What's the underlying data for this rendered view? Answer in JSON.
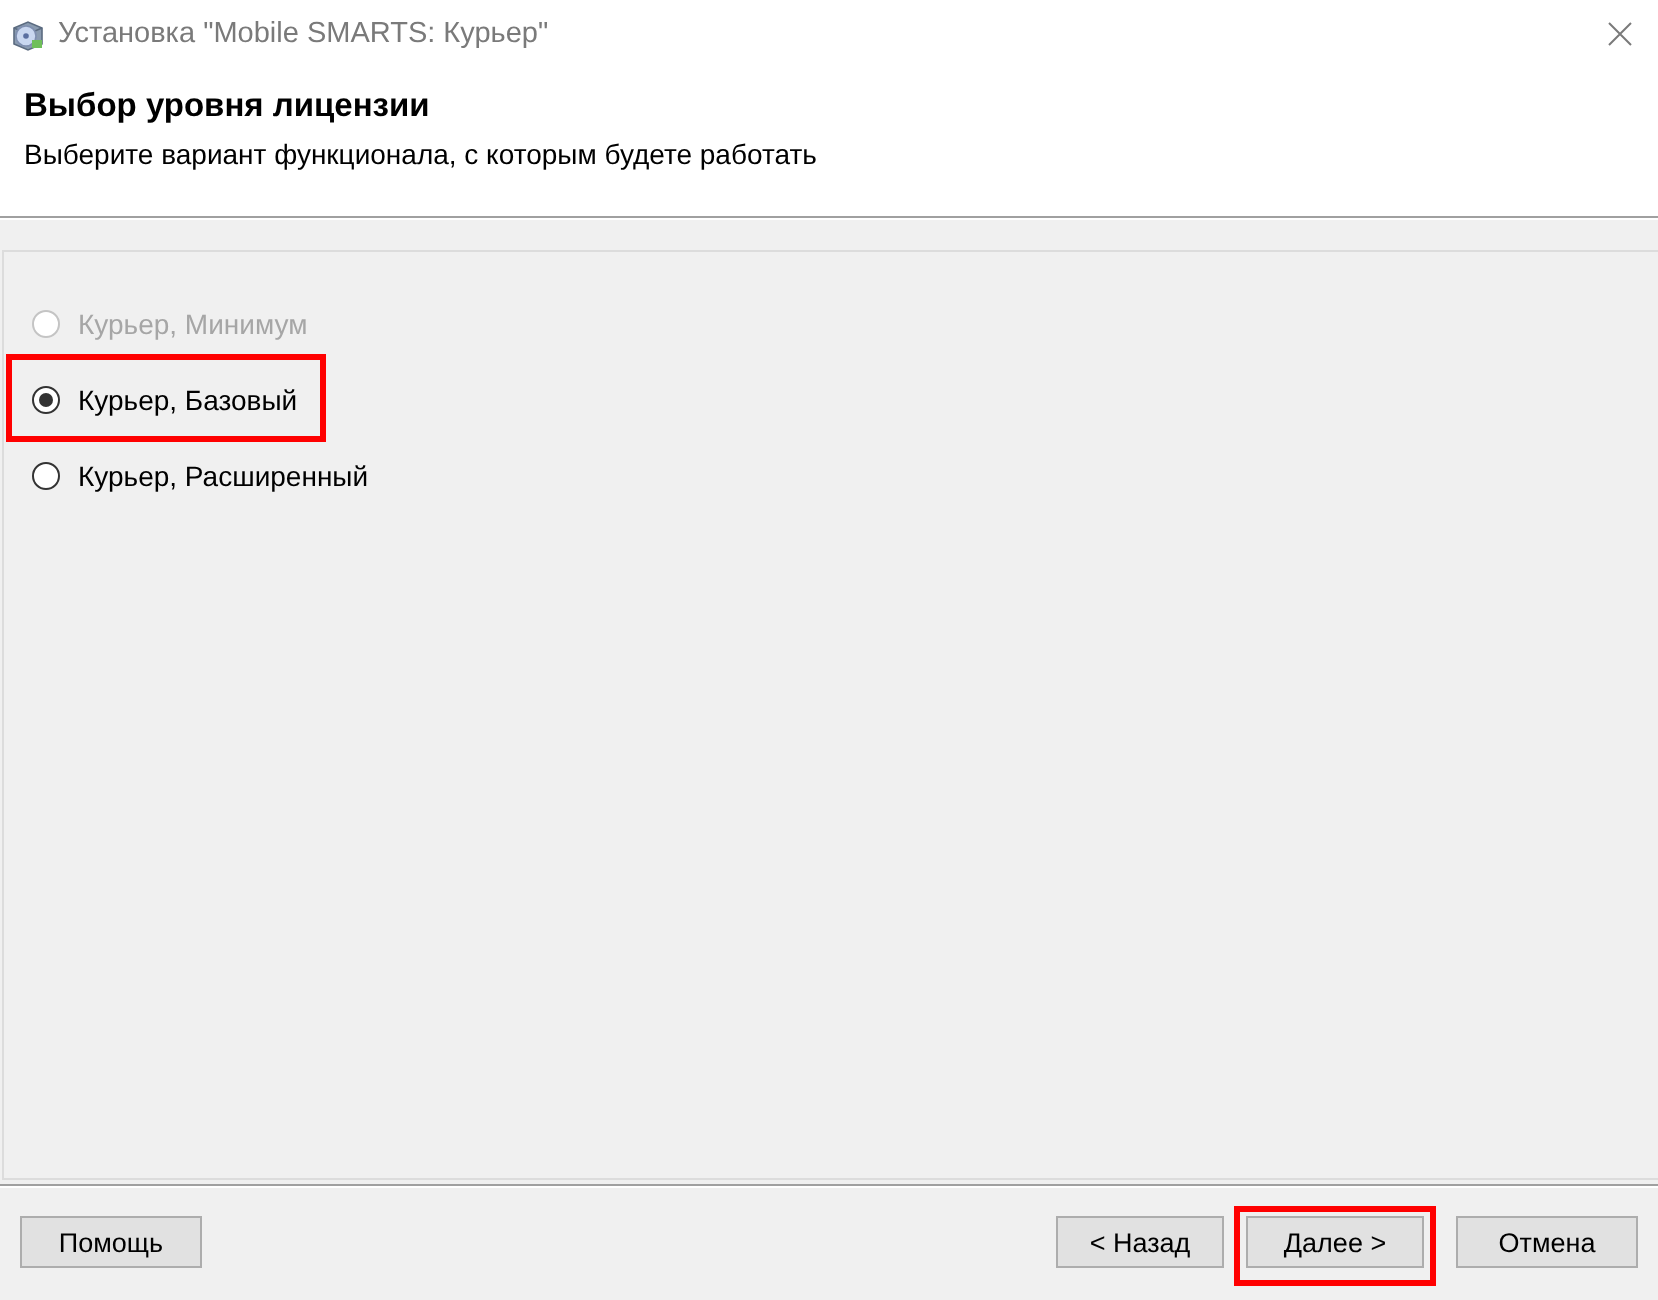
{
  "window": {
    "title": "Установка \"Mobile SMARTS: Курьер\""
  },
  "header": {
    "title": "Выбор уровня лицензии",
    "subtitle": "Выберите вариант функционала, с которым будете работать"
  },
  "options": [
    {
      "label": "Курьер, Минимум",
      "selected": false,
      "disabled": true,
      "highlighted": false
    },
    {
      "label": "Курьер, Базовый",
      "selected": true,
      "disabled": false,
      "highlighted": true
    },
    {
      "label": "Курьер, Расширенный",
      "selected": false,
      "disabled": false,
      "highlighted": false
    }
  ],
  "buttons": [
    {
      "label": "Помощь",
      "kind": "help",
      "highlighted": false
    },
    {
      "label": "< Назад",
      "kind": "back",
      "highlighted": false
    },
    {
      "label": "Далее >",
      "kind": "next",
      "highlighted": true
    },
    {
      "label": "Отмена",
      "kind": "cancel",
      "highlighted": false
    }
  ]
}
